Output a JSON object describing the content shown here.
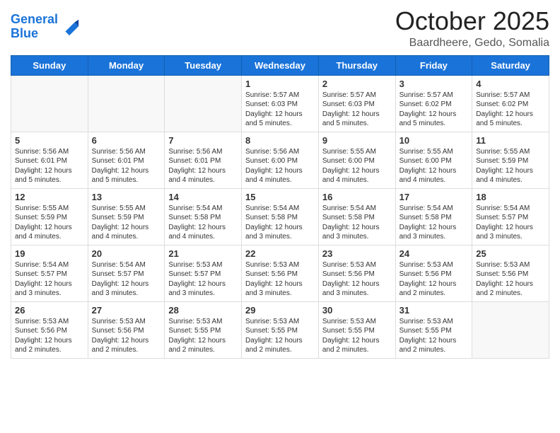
{
  "header": {
    "logo_line1": "General",
    "logo_line2": "Blue",
    "month_title": "October 2025",
    "location": "Baardheere, Gedo, Somalia"
  },
  "days_of_week": [
    "Sunday",
    "Monday",
    "Tuesday",
    "Wednesday",
    "Thursday",
    "Friday",
    "Saturday"
  ],
  "weeks": [
    [
      {
        "day": "",
        "content": ""
      },
      {
        "day": "",
        "content": ""
      },
      {
        "day": "",
        "content": ""
      },
      {
        "day": "1",
        "content": "Sunrise: 5:57 AM\nSunset: 6:03 PM\nDaylight: 12 hours\nand 5 minutes."
      },
      {
        "day": "2",
        "content": "Sunrise: 5:57 AM\nSunset: 6:03 PM\nDaylight: 12 hours\nand 5 minutes."
      },
      {
        "day": "3",
        "content": "Sunrise: 5:57 AM\nSunset: 6:02 PM\nDaylight: 12 hours\nand 5 minutes."
      },
      {
        "day": "4",
        "content": "Sunrise: 5:57 AM\nSunset: 6:02 PM\nDaylight: 12 hours\nand 5 minutes."
      }
    ],
    [
      {
        "day": "5",
        "content": "Sunrise: 5:56 AM\nSunset: 6:01 PM\nDaylight: 12 hours\nand 5 minutes."
      },
      {
        "day": "6",
        "content": "Sunrise: 5:56 AM\nSunset: 6:01 PM\nDaylight: 12 hours\nand 5 minutes."
      },
      {
        "day": "7",
        "content": "Sunrise: 5:56 AM\nSunset: 6:01 PM\nDaylight: 12 hours\nand 4 minutes."
      },
      {
        "day": "8",
        "content": "Sunrise: 5:56 AM\nSunset: 6:00 PM\nDaylight: 12 hours\nand 4 minutes."
      },
      {
        "day": "9",
        "content": "Sunrise: 5:55 AM\nSunset: 6:00 PM\nDaylight: 12 hours\nand 4 minutes."
      },
      {
        "day": "10",
        "content": "Sunrise: 5:55 AM\nSunset: 6:00 PM\nDaylight: 12 hours\nand 4 minutes."
      },
      {
        "day": "11",
        "content": "Sunrise: 5:55 AM\nSunset: 5:59 PM\nDaylight: 12 hours\nand 4 minutes."
      }
    ],
    [
      {
        "day": "12",
        "content": "Sunrise: 5:55 AM\nSunset: 5:59 PM\nDaylight: 12 hours\nand 4 minutes."
      },
      {
        "day": "13",
        "content": "Sunrise: 5:55 AM\nSunset: 5:59 PM\nDaylight: 12 hours\nand 4 minutes."
      },
      {
        "day": "14",
        "content": "Sunrise: 5:54 AM\nSunset: 5:58 PM\nDaylight: 12 hours\nand 4 minutes."
      },
      {
        "day": "15",
        "content": "Sunrise: 5:54 AM\nSunset: 5:58 PM\nDaylight: 12 hours\nand 3 minutes."
      },
      {
        "day": "16",
        "content": "Sunrise: 5:54 AM\nSunset: 5:58 PM\nDaylight: 12 hours\nand 3 minutes."
      },
      {
        "day": "17",
        "content": "Sunrise: 5:54 AM\nSunset: 5:58 PM\nDaylight: 12 hours\nand 3 minutes."
      },
      {
        "day": "18",
        "content": "Sunrise: 5:54 AM\nSunset: 5:57 PM\nDaylight: 12 hours\nand 3 minutes."
      }
    ],
    [
      {
        "day": "19",
        "content": "Sunrise: 5:54 AM\nSunset: 5:57 PM\nDaylight: 12 hours\nand 3 minutes."
      },
      {
        "day": "20",
        "content": "Sunrise: 5:54 AM\nSunset: 5:57 PM\nDaylight: 12 hours\nand 3 minutes."
      },
      {
        "day": "21",
        "content": "Sunrise: 5:53 AM\nSunset: 5:57 PM\nDaylight: 12 hours\nand 3 minutes."
      },
      {
        "day": "22",
        "content": "Sunrise: 5:53 AM\nSunset: 5:56 PM\nDaylight: 12 hours\nand 3 minutes."
      },
      {
        "day": "23",
        "content": "Sunrise: 5:53 AM\nSunset: 5:56 PM\nDaylight: 12 hours\nand 3 minutes."
      },
      {
        "day": "24",
        "content": "Sunrise: 5:53 AM\nSunset: 5:56 PM\nDaylight: 12 hours\nand 2 minutes."
      },
      {
        "day": "25",
        "content": "Sunrise: 5:53 AM\nSunset: 5:56 PM\nDaylight: 12 hours\nand 2 minutes."
      }
    ],
    [
      {
        "day": "26",
        "content": "Sunrise: 5:53 AM\nSunset: 5:56 PM\nDaylight: 12 hours\nand 2 minutes."
      },
      {
        "day": "27",
        "content": "Sunrise: 5:53 AM\nSunset: 5:56 PM\nDaylight: 12 hours\nand 2 minutes."
      },
      {
        "day": "28",
        "content": "Sunrise: 5:53 AM\nSunset: 5:55 PM\nDaylight: 12 hours\nand 2 minutes."
      },
      {
        "day": "29",
        "content": "Sunrise: 5:53 AM\nSunset: 5:55 PM\nDaylight: 12 hours\nand 2 minutes."
      },
      {
        "day": "30",
        "content": "Sunrise: 5:53 AM\nSunset: 5:55 PM\nDaylight: 12 hours\nand 2 minutes."
      },
      {
        "day": "31",
        "content": "Sunrise: 5:53 AM\nSunset: 5:55 PM\nDaylight: 12 hours\nand 2 minutes."
      },
      {
        "day": "",
        "content": ""
      }
    ]
  ]
}
